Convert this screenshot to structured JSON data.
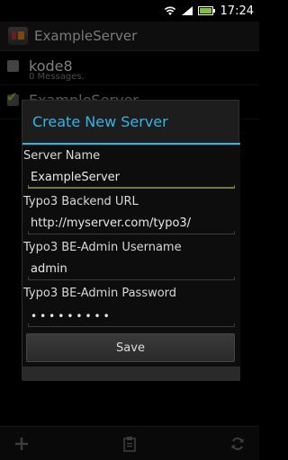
{
  "status_bar": {
    "time": "17:24",
    "icons": [
      "wifi-icon",
      "signal-icon",
      "battery-icon"
    ]
  },
  "action_bar": {
    "title": "ExampleServer",
    "logo": "typo3-server-logo"
  },
  "server_list": [
    {
      "name": "kode8",
      "subtitle": "0 Messages.",
      "checked": false
    },
    {
      "name": "ExampleServer",
      "subtitle": "",
      "checked": true
    }
  ],
  "dialog": {
    "title": "Create New Server",
    "fields": [
      {
        "label": "Server Name",
        "value": "ExampleServer"
      },
      {
        "label": "Typo3 Backend URL",
        "value": "http://myserver.com/typo3/"
      },
      {
        "label": "Typo3 BE-Admin Username",
        "value": "admin"
      },
      {
        "label": "Typo3 BE-Admin Password",
        "value": "•••••••••"
      }
    ],
    "save_label": "Save"
  },
  "bottom_bar": {
    "icons": [
      "add-icon",
      "clipboard-icon",
      "refresh-icon"
    ]
  },
  "colors": {
    "accent": "#33b5e5",
    "focus_line": "#6e7f3b",
    "checkmark": "#9acd32"
  }
}
